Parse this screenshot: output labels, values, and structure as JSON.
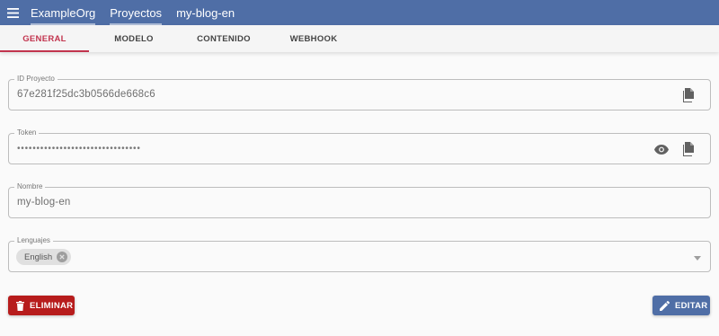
{
  "header": {
    "breadcrumbs": [
      "ExampleOrg",
      "Proyectos",
      "my-blog-en"
    ]
  },
  "tabs": [
    "GENERAL",
    "MODELO",
    "CONTENIDO",
    "WEBHOOK"
  ],
  "fields": {
    "project_id": {
      "label": "ID Proyecto",
      "value": "67e281f25dc3b0566de668c6"
    },
    "token": {
      "label": "Token",
      "value": "••••••••••••••••••••••••••••••••"
    },
    "name": {
      "label": "Nombre",
      "value": "my-blog-en"
    },
    "languages": {
      "label": "Lenguajes",
      "chips": [
        "English"
      ]
    }
  },
  "actions": {
    "delete_label": "ELIMINAR",
    "edit_label": "EDITAR"
  },
  "colors": {
    "appbar": "#4f6ea6",
    "active_tab": "#c2344e",
    "delete_button": "#b71c1c",
    "edit_button": "#4f6ea6"
  },
  "icons": [
    "menu-icon",
    "copy-icon",
    "eye-icon",
    "close-circle-icon",
    "chevron-down-icon",
    "trash-icon",
    "pencil-icon"
  ]
}
